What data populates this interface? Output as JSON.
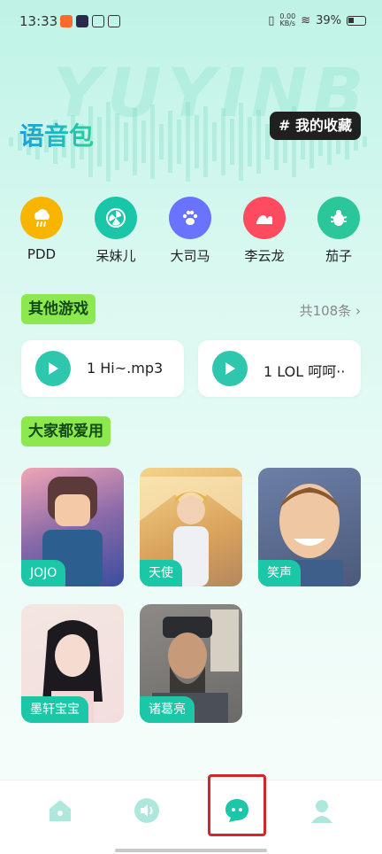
{
  "status_bar": {
    "time": "13:33",
    "speed_value": "0.00",
    "speed_unit": "KB/s",
    "battery": "39%"
  },
  "watermark": "YUYINB",
  "header": {
    "title": "语音包",
    "favorite_label": "# 我的收藏"
  },
  "characters": [
    {
      "label": "PDD",
      "icon": "rain-cloud-icon",
      "color": "#f7b500"
    },
    {
      "label": "呆妹儿",
      "icon": "fan-icon",
      "color": "#19c6a7"
    },
    {
      "label": "大司马",
      "icon": "paw-icon",
      "color": "#6a73ff"
    },
    {
      "label": "李云龙",
      "icon": "wave-icon",
      "color": "#ff4b60"
    },
    {
      "label": "茄子",
      "icon": "bug-icon",
      "color": "#2bc79b"
    }
  ],
  "other_games": {
    "title": "其他游戏",
    "total": "共108条 ›"
  },
  "audio_items": [
    {
      "title": "1 Hi~.mp3"
    },
    {
      "title": "1 LOL 呵呵··"
    }
  ],
  "popular": {
    "title": "大家都爱用"
  },
  "voice_cards": [
    {
      "name": "JOJO"
    },
    {
      "name": "天使"
    },
    {
      "name": "笑声"
    },
    {
      "name": "墨轩宝宝"
    },
    {
      "name": "诸葛亮"
    }
  ],
  "bottom_nav": [
    {
      "icon": "home-icon"
    },
    {
      "icon": "speaker-icon"
    },
    {
      "icon": "chat-icon"
    },
    {
      "icon": "profile-icon"
    }
  ],
  "colors": {
    "accent": "#1cc7a8",
    "badge": "#8de84f",
    "highlight": "#d4242c"
  }
}
